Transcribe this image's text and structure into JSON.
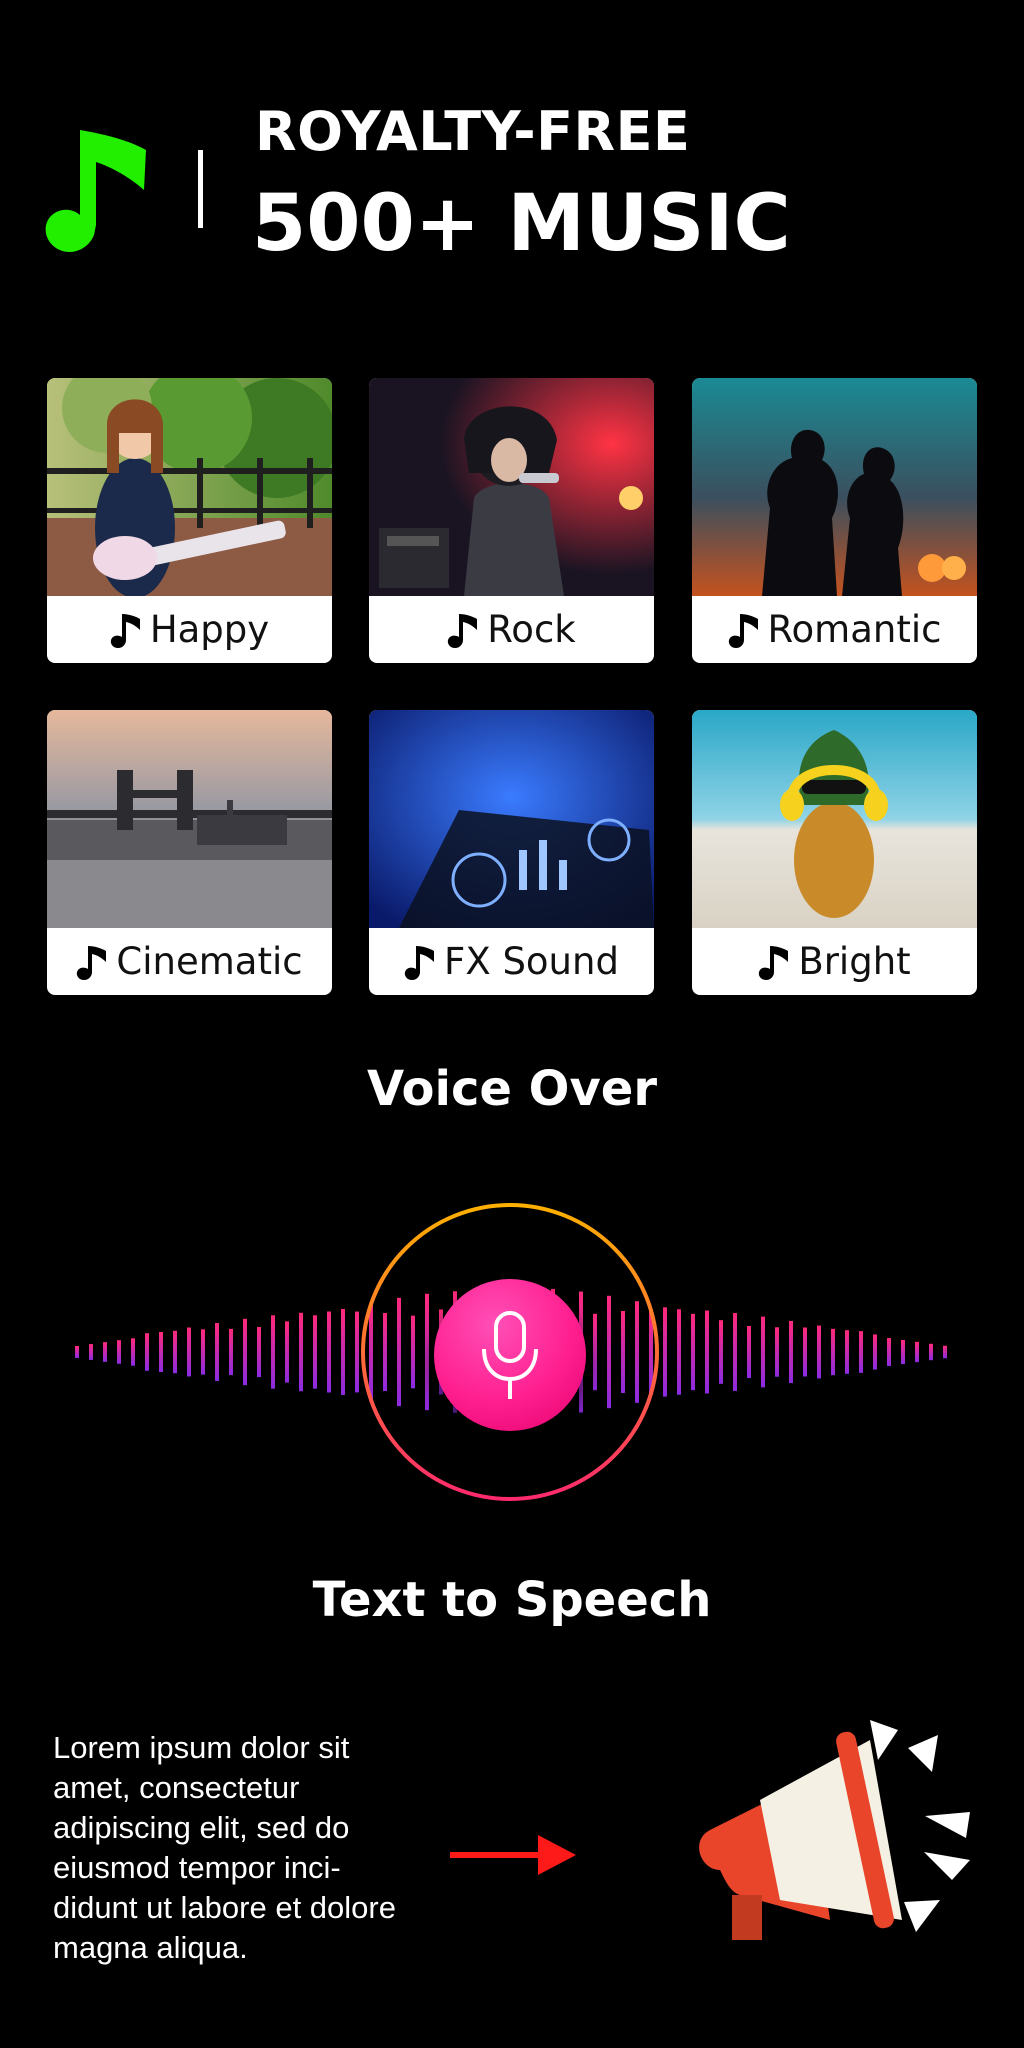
{
  "header": {
    "subtitle": "ROYALTY-FREE",
    "title": "500+ MUSIC",
    "accent_color": "#22ee00"
  },
  "genres": [
    {
      "label": "Happy",
      "icon": "music-note-icon"
    },
    {
      "label": "Rock",
      "icon": "music-note-icon"
    },
    {
      "label": "Romantic",
      "icon": "music-note-icon"
    },
    {
      "label": "Cinematic",
      "icon": "music-note-icon"
    },
    {
      "label": "FX Sound",
      "icon": "music-note-icon"
    },
    {
      "label": "Bright",
      "icon": "music-note-icon"
    }
  ],
  "voice_over": {
    "heading": "Voice Over",
    "icon": "microphone-icon",
    "ring_gradient": [
      "#ffb000",
      "#ff2a6d"
    ],
    "wave_gradient": [
      "#ff2a7a",
      "#8a2be2"
    ]
  },
  "text_to_speech": {
    "heading": "Text to Speech",
    "body": "Lorem ipsum dolor sit amet, consectetur adipiscing elit, sed do eiusmod tempor inci-didunt ut labore et dolore magna aliqua.",
    "arrow_color": "#ff1a1a",
    "icon": "megaphone-icon"
  }
}
